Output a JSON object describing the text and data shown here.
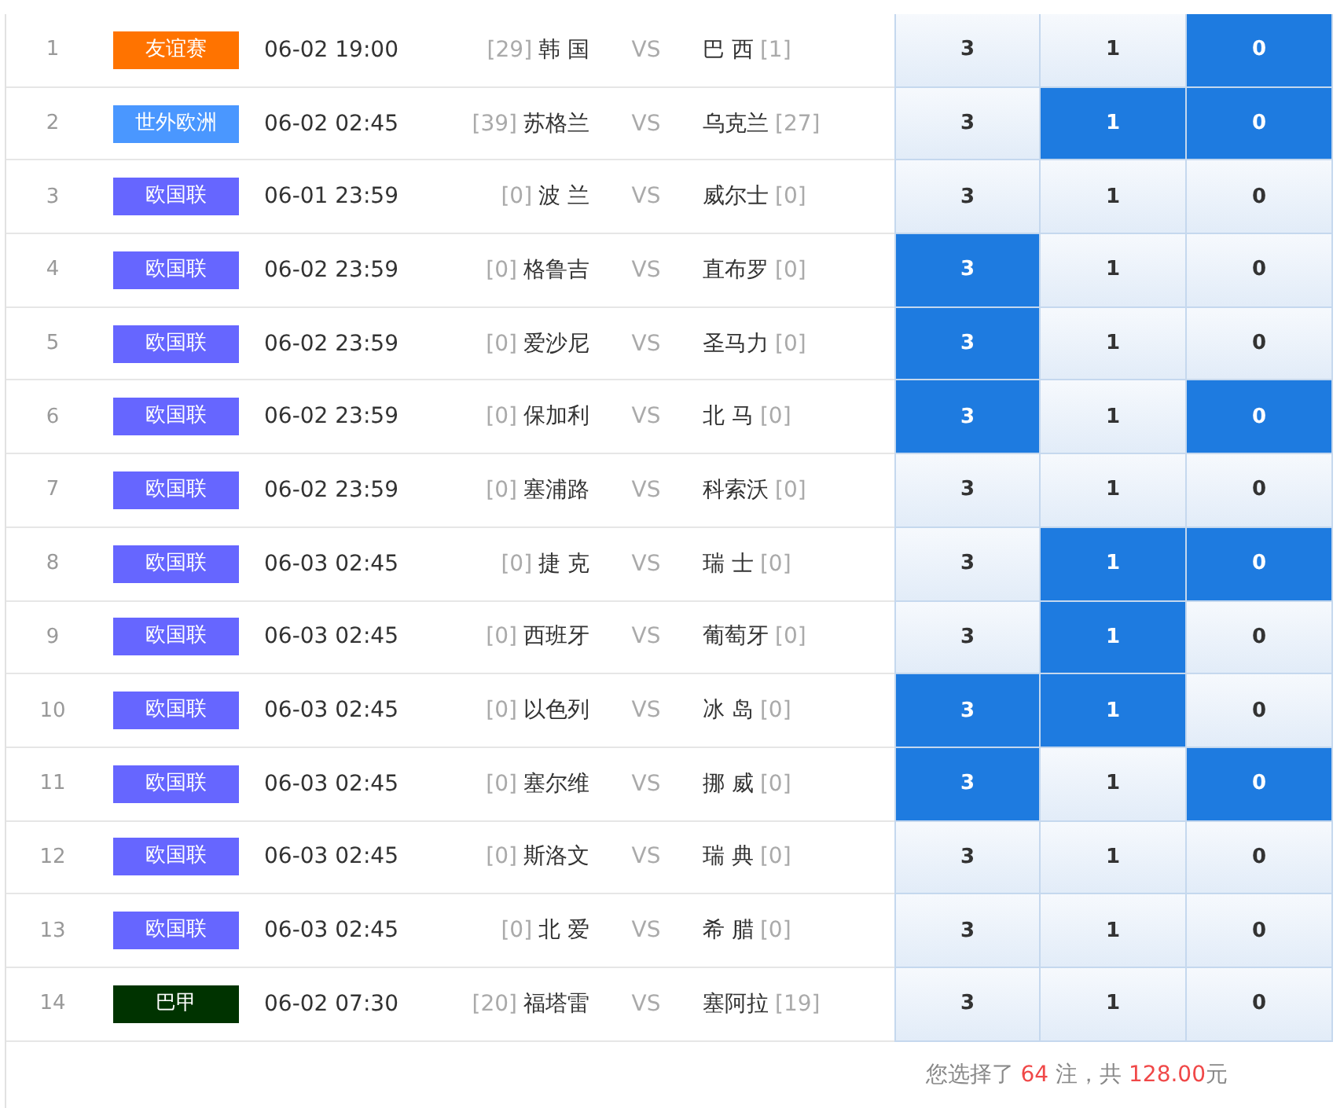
{
  "rows": [
    {
      "no": "1",
      "league": "友谊赛",
      "color": "#ff7300",
      "time": "06-02 19:00",
      "home_rank": "[29]",
      "home": "韩 国",
      "vs": "VS",
      "away": "巴 西",
      "away_rank": "[1]",
      "odds": [
        {
          "label": "3",
          "selected": false
        },
        {
          "label": "1",
          "selected": false
        },
        {
          "label": "0",
          "selected": true
        }
      ]
    },
    {
      "no": "2",
      "league": "世外欧洲",
      "color": "#4a97ff",
      "time": "06-02 02:45",
      "home_rank": "[39]",
      "home": "苏格兰",
      "vs": "VS",
      "away": "乌克兰",
      "away_rank": "[27]",
      "odds": [
        {
          "label": "3",
          "selected": false
        },
        {
          "label": "1",
          "selected": true
        },
        {
          "label": "0",
          "selected": true
        }
      ]
    },
    {
      "no": "3",
      "league": "欧国联",
      "color": "#6666ff",
      "time": "06-01 23:59",
      "home_rank": "[0]",
      "home": "波 兰",
      "vs": "VS",
      "away": "威尔士",
      "away_rank": "[0]",
      "odds": [
        {
          "label": "3",
          "selected": false
        },
        {
          "label": "1",
          "selected": false
        },
        {
          "label": "0",
          "selected": false
        }
      ]
    },
    {
      "no": "4",
      "league": "欧国联",
      "color": "#6666ff",
      "time": "06-02 23:59",
      "home_rank": "[0]",
      "home": "格鲁吉",
      "vs": "VS",
      "away": "直布罗",
      "away_rank": "[0]",
      "odds": [
        {
          "label": "3",
          "selected": true
        },
        {
          "label": "1",
          "selected": false
        },
        {
          "label": "0",
          "selected": false
        }
      ]
    },
    {
      "no": "5",
      "league": "欧国联",
      "color": "#6666ff",
      "time": "06-02 23:59",
      "home_rank": "[0]",
      "home": "爱沙尼",
      "vs": "VS",
      "away": "圣马力",
      "away_rank": "[0]",
      "odds": [
        {
          "label": "3",
          "selected": true
        },
        {
          "label": "1",
          "selected": false
        },
        {
          "label": "0",
          "selected": false
        }
      ]
    },
    {
      "no": "6",
      "league": "欧国联",
      "color": "#6666ff",
      "time": "06-02 23:59",
      "home_rank": "[0]",
      "home": "保加利",
      "vs": "VS",
      "away": "北 马",
      "away_rank": "[0]",
      "odds": [
        {
          "label": "3",
          "selected": true
        },
        {
          "label": "1",
          "selected": false
        },
        {
          "label": "0",
          "selected": true
        }
      ]
    },
    {
      "no": "7",
      "league": "欧国联",
      "color": "#6666ff",
      "time": "06-02 23:59",
      "home_rank": "[0]",
      "home": "塞浦路",
      "vs": "VS",
      "away": "科索沃",
      "away_rank": "[0]",
      "odds": [
        {
          "label": "3",
          "selected": false
        },
        {
          "label": "1",
          "selected": false
        },
        {
          "label": "0",
          "selected": false
        }
      ]
    },
    {
      "no": "8",
      "league": "欧国联",
      "color": "#6666ff",
      "time": "06-03 02:45",
      "home_rank": "[0]",
      "home": "捷 克",
      "vs": "VS",
      "away": "瑞 士",
      "away_rank": "[0]",
      "odds": [
        {
          "label": "3",
          "selected": false
        },
        {
          "label": "1",
          "selected": true
        },
        {
          "label": "0",
          "selected": true
        }
      ]
    },
    {
      "no": "9",
      "league": "欧国联",
      "color": "#6666ff",
      "time": "06-03 02:45",
      "home_rank": "[0]",
      "home": "西班牙",
      "vs": "VS",
      "away": "葡萄牙",
      "away_rank": "[0]",
      "odds": [
        {
          "label": "3",
          "selected": false
        },
        {
          "label": "1",
          "selected": true
        },
        {
          "label": "0",
          "selected": false
        }
      ]
    },
    {
      "no": "10",
      "league": "欧国联",
      "color": "#6666ff",
      "time": "06-03 02:45",
      "home_rank": "[0]",
      "home": "以色列",
      "vs": "VS",
      "away": "冰 岛",
      "away_rank": "[0]",
      "odds": [
        {
          "label": "3",
          "selected": true
        },
        {
          "label": "1",
          "selected": true
        },
        {
          "label": "0",
          "selected": false
        }
      ]
    },
    {
      "no": "11",
      "league": "欧国联",
      "color": "#6666ff",
      "time": "06-03 02:45",
      "home_rank": "[0]",
      "home": "塞尔维",
      "vs": "VS",
      "away": "挪 威",
      "away_rank": "[0]",
      "odds": [
        {
          "label": "3",
          "selected": true
        },
        {
          "label": "1",
          "selected": false
        },
        {
          "label": "0",
          "selected": true
        }
      ]
    },
    {
      "no": "12",
      "league": "欧国联",
      "color": "#6666ff",
      "time": "06-03 02:45",
      "home_rank": "[0]",
      "home": "斯洛文",
      "vs": "VS",
      "away": "瑞 典",
      "away_rank": "[0]",
      "odds": [
        {
          "label": "3",
          "selected": false
        },
        {
          "label": "1",
          "selected": false
        },
        {
          "label": "0",
          "selected": false
        }
      ]
    },
    {
      "no": "13",
      "league": "欧国联",
      "color": "#6666ff",
      "time": "06-03 02:45",
      "home_rank": "[0]",
      "home": "北 爱",
      "vs": "VS",
      "away": "希 腊",
      "away_rank": "[0]",
      "odds": [
        {
          "label": "3",
          "selected": false
        },
        {
          "label": "1",
          "selected": false
        },
        {
          "label": "0",
          "selected": false
        }
      ]
    },
    {
      "no": "14",
      "league": "巴甲",
      "color": "#003300",
      "time": "06-02 07:30",
      "home_rank": "[20]",
      "home": "福塔雷",
      "vs": "VS",
      "away": "塞阿拉",
      "away_rank": "[19]",
      "odds": [
        {
          "label": "3",
          "selected": false
        },
        {
          "label": "1",
          "selected": false
        },
        {
          "label": "0",
          "selected": false
        }
      ]
    }
  ],
  "summary": {
    "prefix": "您选择了",
    "count": "64",
    "middle": "注，共",
    "amount": "128.00",
    "suffix": "元"
  }
}
